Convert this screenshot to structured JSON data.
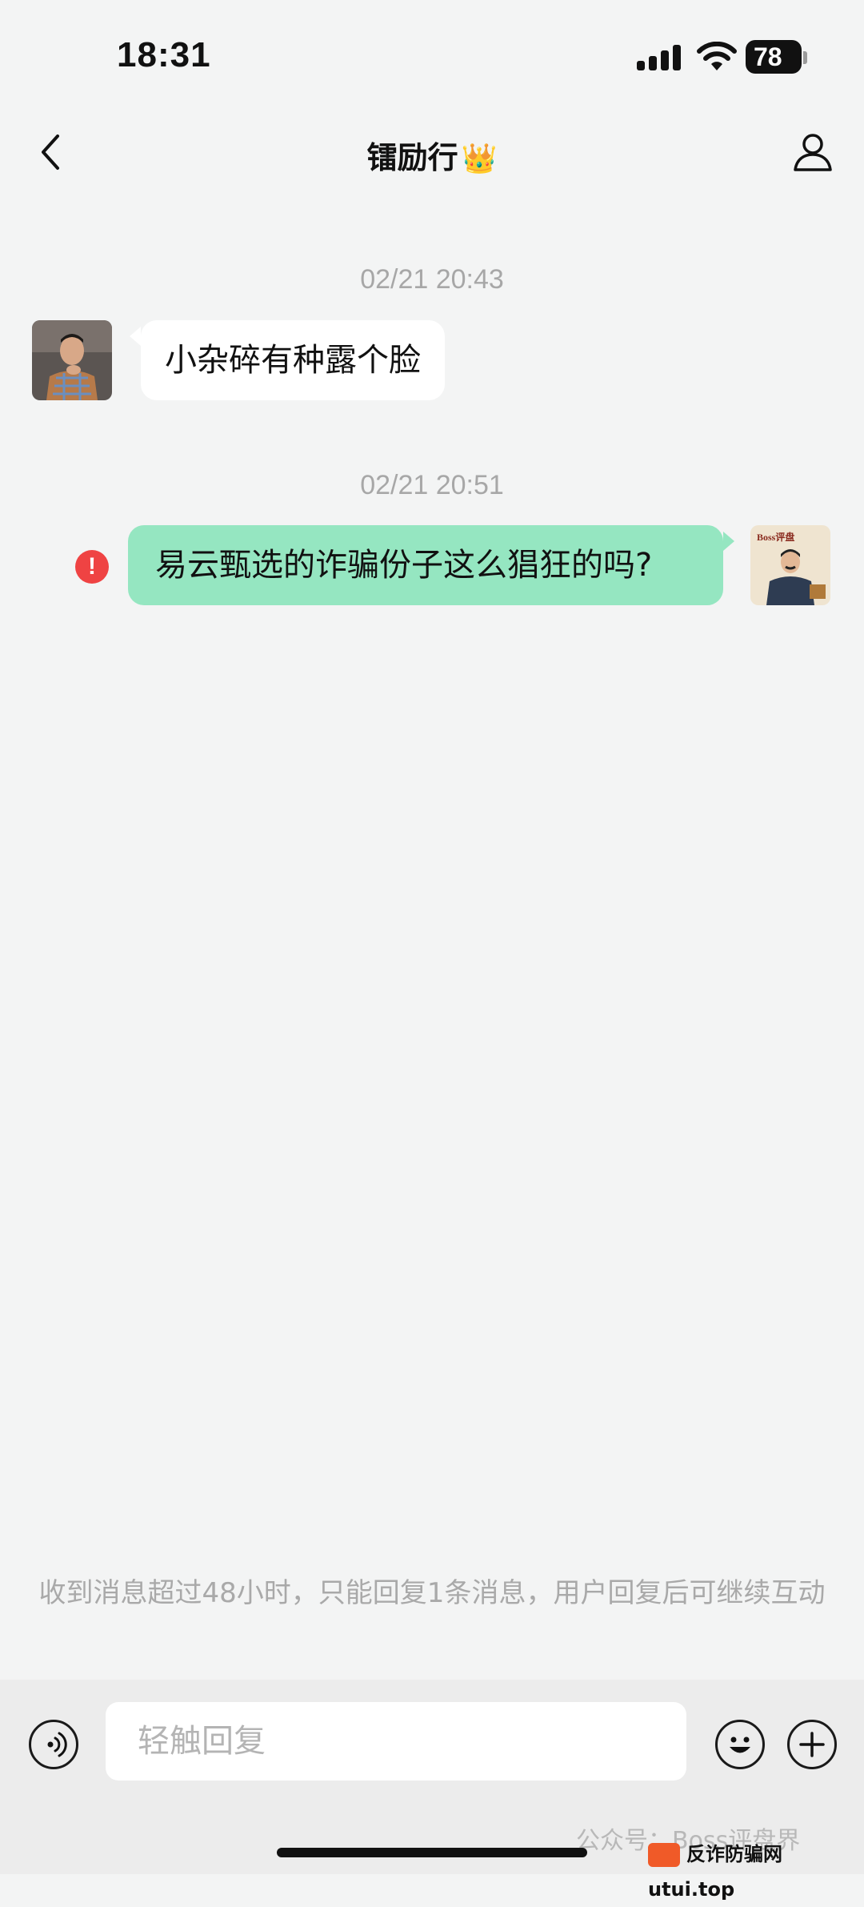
{
  "status_bar": {
    "time": "18:31",
    "battery": "78",
    "signal_icon": "cellular-signal-icon",
    "wifi_icon": "wifi-icon"
  },
  "header": {
    "title": "镭励行",
    "title_emoji": "👑",
    "back_icon": "chevron-left-icon",
    "profile_icon": "person-icon"
  },
  "messages": [
    {
      "timestamp": "02/21 20:43",
      "direction": "incoming",
      "text": "小杂碎有种露个脸"
    },
    {
      "timestamp": "02/21 20:51",
      "direction": "outgoing",
      "text": "易云甄选的诈骗份子这么猖狂的吗?",
      "status": "failed",
      "status_glyph": "!",
      "avatar_text": "Boss评盘"
    }
  ],
  "notice": "收到消息超过48小时，只能回复1条消息，用户回复后可继续互动",
  "input_bar": {
    "placeholder": "轻触回复",
    "voice_icon": "voice-icon",
    "emoji_icon": "smiley-icon",
    "plus_icon": "plus-icon"
  },
  "watermark": "公众号：Boss评盘界",
  "site_badge": "反诈防骗网 utui.top",
  "colors": {
    "background": "#f3f4f4",
    "outgoing_bubble": "#95e6c1",
    "incoming_bubble": "#ffffff",
    "error": "#ef4343",
    "timestamp": "#a7a7a7"
  }
}
